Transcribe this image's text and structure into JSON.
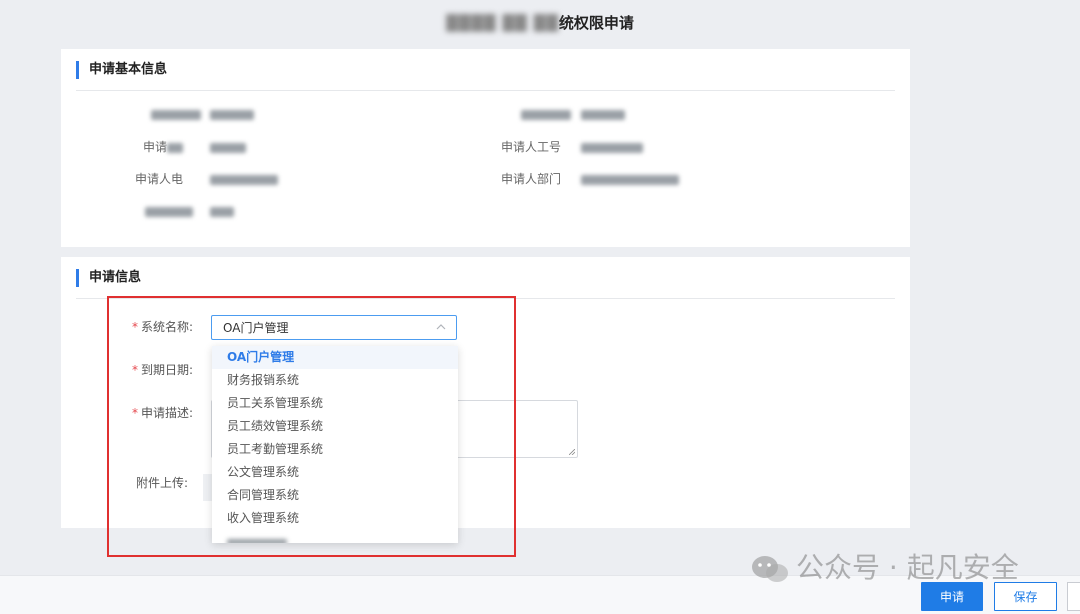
{
  "page": {
    "title_visible_part": "统权限申请"
  },
  "basic_info": {
    "section_title": "申请基本信息",
    "rows": [
      {
        "left_label": "",
        "left_value": "",
        "right_label": "",
        "right_value": ""
      },
      {
        "left_label": "申请",
        "left_value": "",
        "right_label": "申请人工号",
        "right_value": ""
      },
      {
        "left_label": "申请人电",
        "left_value": "",
        "right_label": "申请人部门",
        "right_value": ""
      },
      {
        "left_label": "",
        "left_value": ""
      }
    ]
  },
  "application": {
    "section_title": "申请信息",
    "required_mark": "*",
    "system_label": "系统名称:",
    "system_selected": "OA门户管理",
    "due_label": "到期日期:",
    "desc_label": "申请描述:",
    "attach_label": "附件上传:"
  },
  "dropdown": {
    "options": [
      "OA门户管理",
      "财务报销系统",
      "员工关系管理系统",
      "员工绩效管理系统",
      "员工考勤管理系统",
      "公文管理系统",
      "合同管理系统",
      "收入管理系统"
    ],
    "selected_index": 0
  },
  "footer": {
    "submit_label": "申请",
    "save_label": "保存"
  },
  "watermark": {
    "text": "公众号 · 起凡安全"
  },
  "colors": {
    "accent": "#2f7ce8",
    "highlight": "#e03030",
    "required": "#e5484d",
    "primary_button": "#1f7ce6"
  }
}
